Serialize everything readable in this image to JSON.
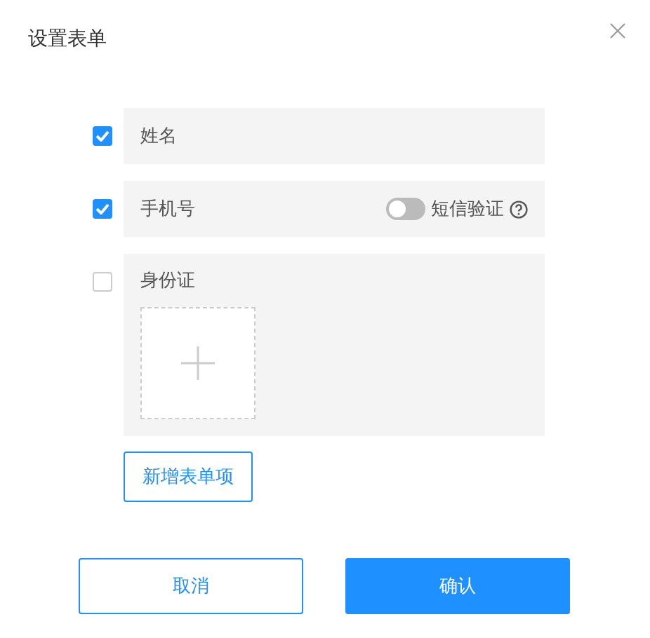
{
  "dialog": {
    "title": "设置表单"
  },
  "fields": [
    {
      "kind": "plain",
      "label": "姓名",
      "checked": true
    },
    {
      "kind": "sms",
      "label": "手机号",
      "checked": true,
      "toggle": {
        "label": "短信验证",
        "on": false
      }
    },
    {
      "kind": "upload",
      "label": "身份证",
      "checked": false
    }
  ],
  "add_button": "新增表单项",
  "buttons": [
    {
      "label": "取消",
      "kind": "secondary"
    },
    {
      "label": "确认",
      "kind": "primary"
    }
  ]
}
